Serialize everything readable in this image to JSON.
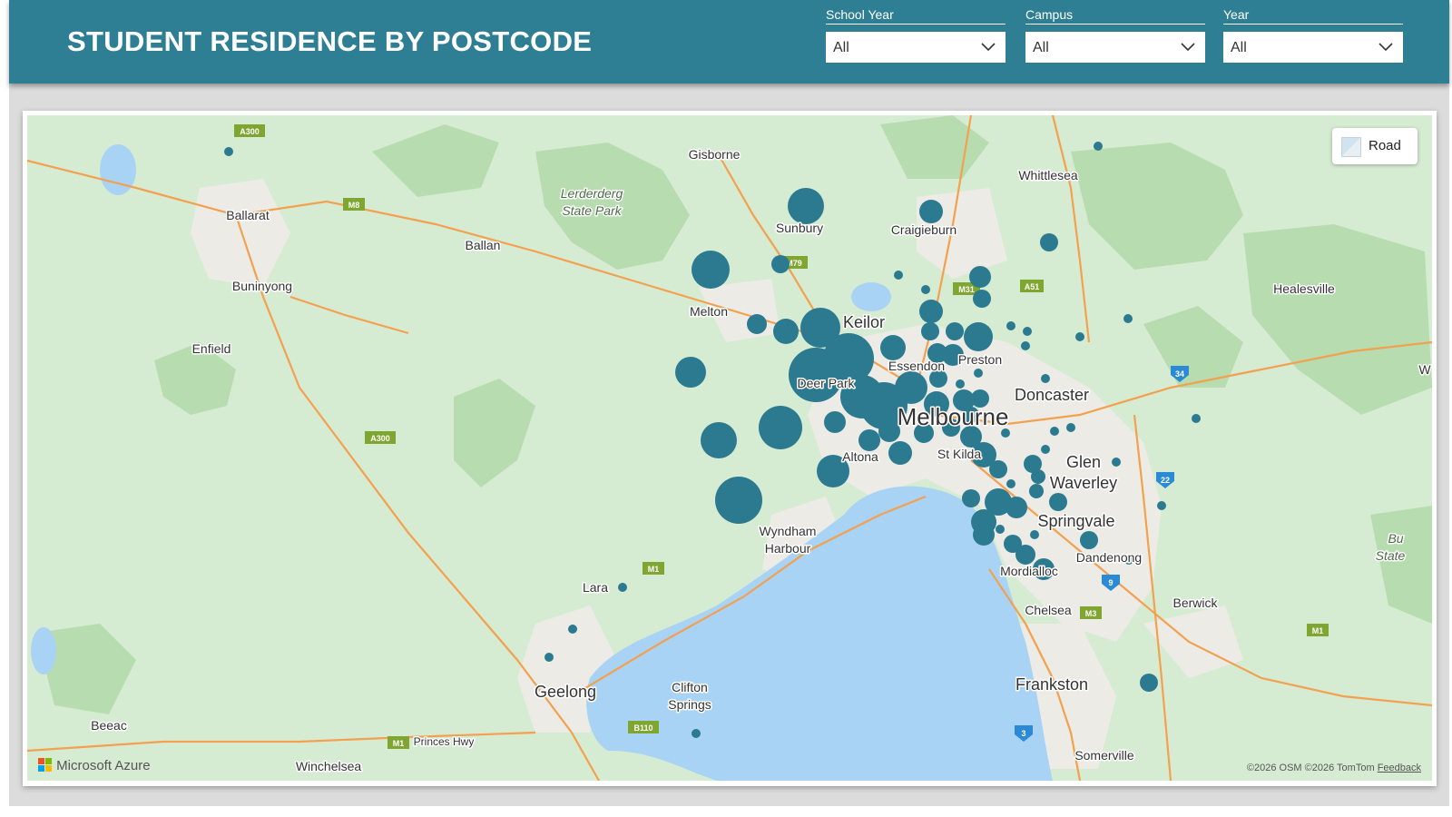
{
  "header": {
    "title": "STUDENT RESIDENCE BY POSTCODE",
    "filters": [
      {
        "label": "School Year",
        "value": "All"
      },
      {
        "label": "Campus",
        "value": "All"
      },
      {
        "label": "Year",
        "value": "All"
      }
    ]
  },
  "map": {
    "style_button": "Road",
    "attribution_brand": "Microsoft Azure",
    "copyright": "©2026 OSM  ©2026 TomTom",
    "feedback_link": "Feedback",
    "place_labels": {
      "gisborne": "Gisborne",
      "whittlesea": "Whittlesea",
      "lerderderg_1": "Lerderderg",
      "lerderderg_2": "State Park",
      "ballarat": "Ballarat",
      "sunbury": "Sunbury",
      "craigieburn": "Craigieburn",
      "ballan": "Ballan",
      "buninyong": "Buninyong",
      "healesville": "Healesville",
      "melton": "Melton",
      "keilor": "Keilor",
      "enfield": "Enfield",
      "essendon": "Essendon",
      "preston": "Preston",
      "deer_park": "Deer Park",
      "doncaster": "Doncaster",
      "melbourne": "Melbourne",
      "st_kilda": "St Kilda",
      "altona": "Altona",
      "glen": "Glen",
      "waverley": "Waverley",
      "springvale": "Springvale",
      "wyndham_1": "Wyndham",
      "wyndham_2": "Harbour",
      "dandenong": "Dandenong",
      "mordialloc": "Mordialloc",
      "lara": "Lara",
      "berwick": "Berwick",
      "chelsea": "Chelsea",
      "geelong": "Geelong",
      "clifton_1": "Clifton",
      "clifton_2": "Springs",
      "frankston": "Frankston",
      "beeac": "Beeac",
      "princes_hwy": "Princes Hwy",
      "winchelsea": "Winchelsea",
      "somerville": "Somerville",
      "bunyip_1": "Bu",
      "bunyip_2": "State",
      "edge_w": "W"
    },
    "road_shields": [
      "A300",
      "M8",
      "M79",
      "M31",
      "A51",
      "A300",
      "M1",
      "M3",
      "M1",
      "B110",
      "M1"
    ],
    "route_badges": [
      "34",
      "22",
      "9",
      "3"
    ]
  },
  "colors": {
    "header_bg": "#2f7f94",
    "bubble": "#2b7a90",
    "land": "#d6ecd2",
    "water": "#a9d3f4",
    "road": "#f3a04f"
  }
}
